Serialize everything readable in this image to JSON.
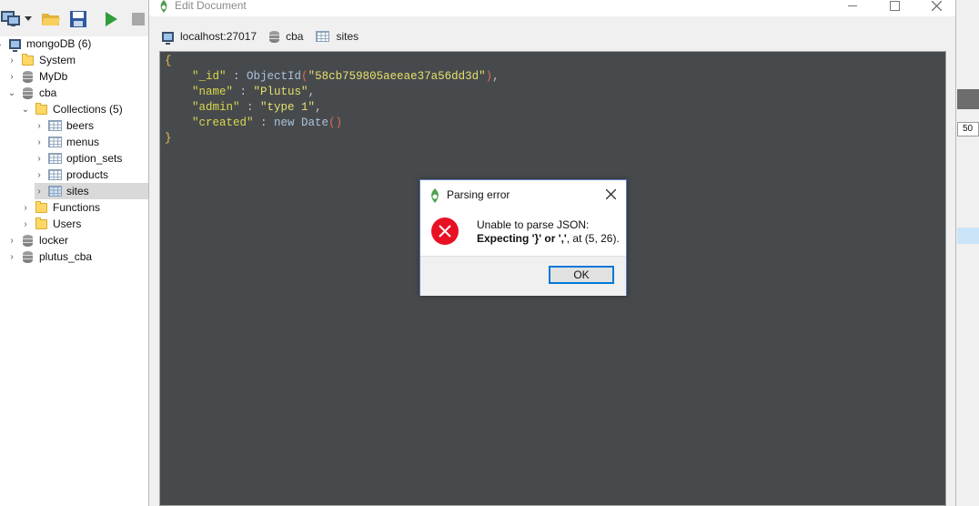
{
  "window": {
    "title": "Edit Document"
  },
  "breadcrumb": {
    "host": "localhost:27017",
    "database": "cba",
    "collection": "sites"
  },
  "tree": {
    "root": "mongoDB (6)",
    "items": [
      {
        "label": "System",
        "type": "folder",
        "expanded": false
      },
      {
        "label": "MyDb",
        "type": "database",
        "expanded": false
      },
      {
        "label": "cba",
        "type": "database",
        "expanded": true
      },
      {
        "label": "Collections (5)",
        "type": "folder",
        "expanded": true
      },
      {
        "label": "beers",
        "type": "collection"
      },
      {
        "label": "menus",
        "type": "collection"
      },
      {
        "label": "option_sets",
        "type": "collection"
      },
      {
        "label": "products",
        "type": "collection"
      },
      {
        "label": "sites",
        "type": "collection",
        "selected": true
      },
      {
        "label": "Functions",
        "type": "folder"
      },
      {
        "label": "Users",
        "type": "folder"
      },
      {
        "label": "locker",
        "type": "database"
      },
      {
        "label": "plutus_cba",
        "type": "database"
      }
    ]
  },
  "document": {
    "open": "{",
    "close": "}",
    "fields": [
      {
        "key": "\"_id\"",
        "sep": " : ",
        "fn": "ObjectId",
        "arg": "\"58cb759805aeeae37a56dd3d\"",
        "trail": ","
      },
      {
        "key": "\"name\"",
        "sep": " : ",
        "value": "\"Plutus\"",
        "trail": ","
      },
      {
        "key": "\"admin\"",
        "sep": " : ",
        "value": "\"type 1\"",
        "trail": ","
      },
      {
        "key": "\"created\"",
        "sep": " : ",
        "fn": "new Date",
        "arg": ""
      }
    ]
  },
  "dialog": {
    "title": "Parsing error",
    "message_line1": "Unable to parse JSON:",
    "message_bold": "Expecting '}' or ','",
    "message_rest": ", at (5, 26).",
    "ok_label": "OK"
  },
  "right_panel": {
    "page_size": "50"
  },
  "colors": {
    "editor_bg": "#474a4d",
    "error_red": "#e81123",
    "accent": "#0078d7"
  }
}
